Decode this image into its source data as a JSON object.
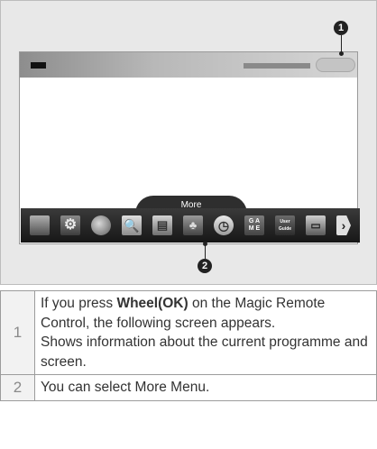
{
  "screen": {
    "more_tab_label": "More"
  },
  "menu_bar": {
    "icons": [
      {
        "name": "tv-icon",
        "glyph": ""
      },
      {
        "name": "gear-icon",
        "glyph": "⚙"
      },
      {
        "name": "globe-icon",
        "glyph": ""
      },
      {
        "name": "search-icon",
        "glyph": "🔍"
      },
      {
        "name": "tv-guide-icon",
        "glyph": "▤"
      },
      {
        "name": "bell-icon",
        "glyph": "♣"
      },
      {
        "name": "clock-icon",
        "glyph": "◷"
      },
      {
        "name": "game-icon",
        "glyph": "G A\nM E"
      },
      {
        "name": "user-guide-icon",
        "glyph": "User\nGuide"
      },
      {
        "name": "input-icon",
        "glyph": "▭"
      },
      {
        "name": "arrow-right-icon",
        "glyph": "›"
      }
    ]
  },
  "callouts": {
    "one": "1",
    "two": "2"
  },
  "legend": {
    "rows": [
      {
        "number": "1",
        "text_before_bold": "If you press ",
        "bold": "Wheel(OK)",
        "text_after_bold": " on the Magic Remote Control, the following screen appears.",
        "line2": "Shows information about the current programme and screen."
      },
      {
        "number": "2",
        "text": "You can select More Menu."
      }
    ]
  }
}
